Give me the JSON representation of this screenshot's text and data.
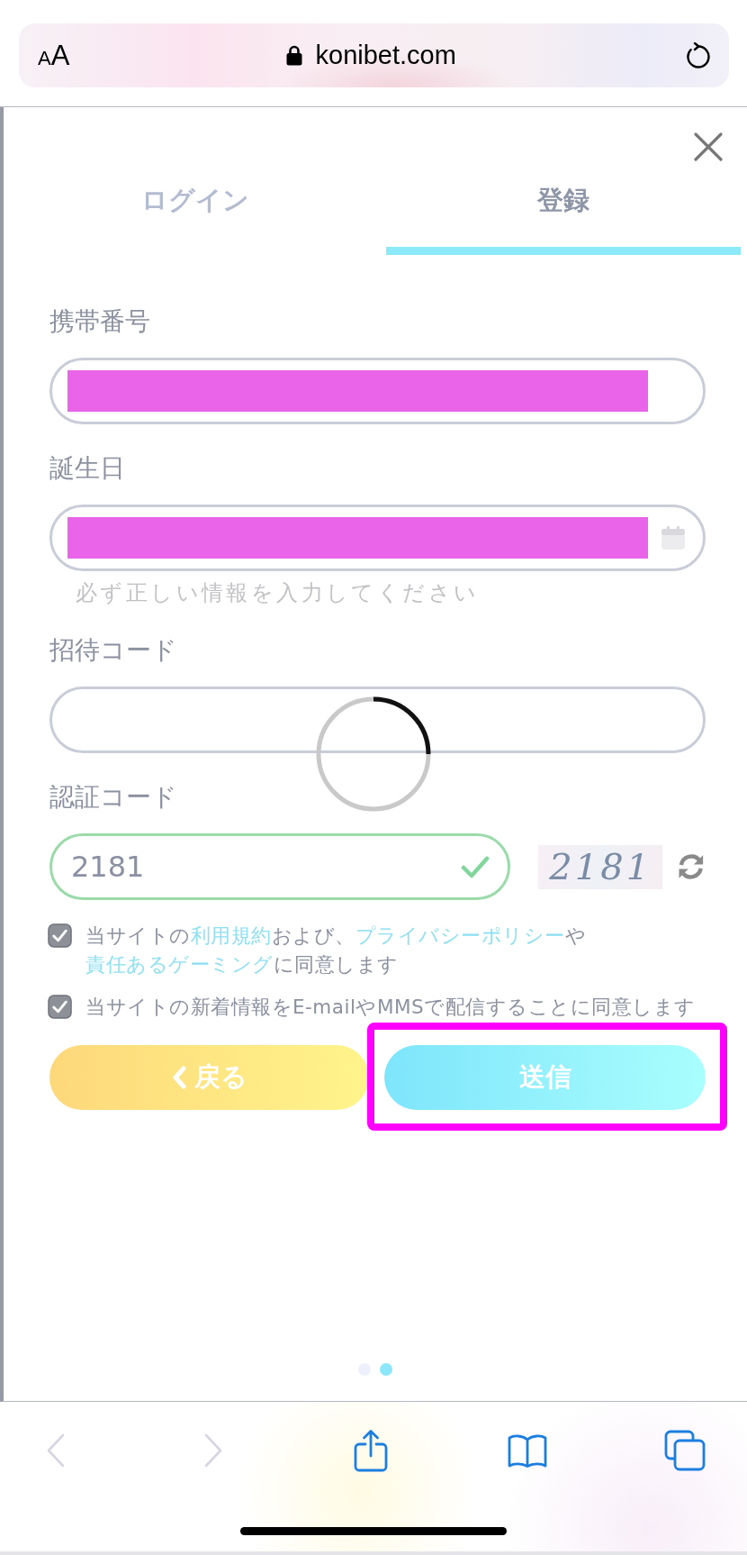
{
  "browser": {
    "text_size_button": "AA",
    "secure": true,
    "url": "konibet.com"
  },
  "modal": {
    "tabs": [
      {
        "label": "ログイン",
        "selected": false
      },
      {
        "label": "登録",
        "selected": true
      }
    ],
    "fields": [
      {
        "kind": "text",
        "label": "携帯番号",
        "redacted": true
      },
      {
        "kind": "date",
        "label": "誕生日",
        "redacted": true,
        "hint": "必ず正しい情報を入力してください"
      },
      {
        "kind": "text",
        "label": "招待コード",
        "redacted": false
      },
      {
        "kind": "captcha",
        "label": "認証コード",
        "value": "2181",
        "valid": true,
        "captcha_image_text": "2181"
      }
    ],
    "loading": true,
    "agreements": [
      {
        "checked": true,
        "parts": [
          {
            "kind": "text",
            "text": "当サイトの"
          },
          {
            "kind": "link",
            "text": "利用規約"
          },
          {
            "kind": "text",
            "text": "および、"
          },
          {
            "kind": "link",
            "text": "プライバシーポリシー"
          },
          {
            "kind": "text",
            "text": "や"
          },
          {
            "kind": "link",
            "text": "責任あるゲーミング"
          },
          {
            "kind": "text",
            "text": "に同意します"
          }
        ]
      },
      {
        "checked": true,
        "parts": [
          {
            "kind": "text",
            "text": "当サイトの新着情報をE-mailやMMSで配信することに同意します"
          }
        ]
      }
    ],
    "buttons": [
      {
        "kind": "back",
        "label": "戻る",
        "highlighted": false
      },
      {
        "kind": "submit",
        "label": "送信",
        "highlighted": true
      }
    ],
    "pager": [
      {
        "selected": false
      },
      {
        "selected": true
      }
    ]
  },
  "toolbar": [
    {
      "kind": "back",
      "disabled": true
    },
    {
      "kind": "forward",
      "disabled": true
    },
    {
      "kind": "share",
      "disabled": false
    },
    {
      "kind": "bookmarks",
      "disabled": false
    },
    {
      "kind": "tabs",
      "disabled": false
    }
  ]
}
